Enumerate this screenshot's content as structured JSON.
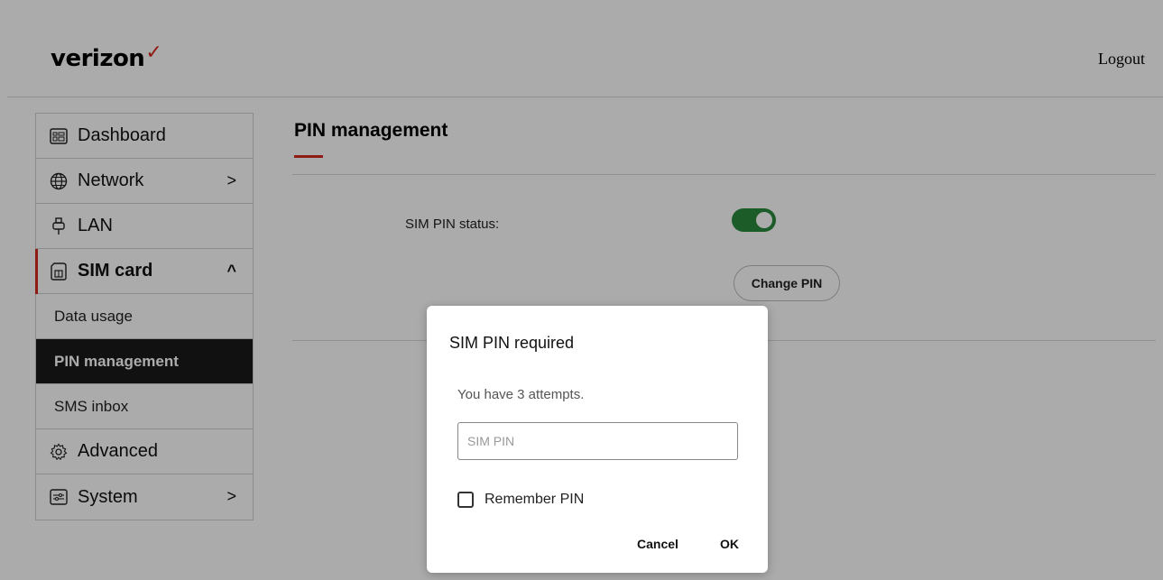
{
  "header": {
    "brand": "verizon",
    "logout_label": "Logout"
  },
  "sidebar": {
    "items": [
      {
        "label": "Dashboard",
        "icon": "dashboard-icon"
      },
      {
        "label": "Network",
        "icon": "network-globe-icon",
        "chevron": ">"
      },
      {
        "label": "LAN",
        "icon": "lan-plug-icon"
      },
      {
        "label": "SIM card",
        "icon": "sim-card-icon",
        "chevron": "^"
      },
      {
        "label": "Advanced",
        "icon": "gear-icon"
      },
      {
        "label": "System",
        "icon": "sliders-icon",
        "chevron": ">"
      }
    ],
    "sim_subitems": [
      {
        "label": "Data usage"
      },
      {
        "label": "PIN management",
        "active": true
      },
      {
        "label": "SMS inbox"
      }
    ]
  },
  "main": {
    "title": "PIN management",
    "sim_pin_status_label": "SIM PIN status:",
    "sim_pin_enabled": true,
    "change_pin_label": "Change PIN"
  },
  "dialog": {
    "title": "SIM PIN required",
    "message": "You have 3 attempts.",
    "input_placeholder": "SIM PIN",
    "input_value": "",
    "remember_label": "Remember PIN",
    "remember_checked": false,
    "cancel_label": "Cancel",
    "ok_label": "OK"
  },
  "colors": {
    "brand_red": "#d52b1e",
    "toggle_on": "#2a8a3e",
    "active_nav_bg": "#1a1a1a"
  }
}
